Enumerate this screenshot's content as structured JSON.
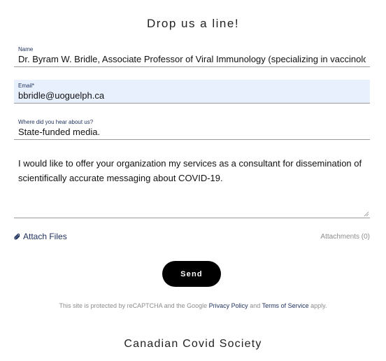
{
  "form": {
    "title": "Drop us a line!",
    "fields": {
      "name": {
        "label": "Name",
        "value": "Dr. Byram W. Bridle, Associate Professor of Viral Immunology (specializing in vaccinology)"
      },
      "email": {
        "label": "Email*",
        "value": "bbridle@uoguelph.ca"
      },
      "source": {
        "label": "Where did you hear about us?",
        "value": "State-funded media."
      },
      "message": {
        "value": "I would like to offer your organization my services as a consultant for dissemination of scientifically accurate messaging about COVID-19."
      }
    },
    "attach_label": "Attach Files",
    "attachments_count": "Attachments (0)",
    "send_label": "Send"
  },
  "recaptcha": {
    "prefix": "This site is protected by reCAPTCHA and the Google",
    "privacy_link": "Privacy Policy",
    "conjunction": "and",
    "terms_link": "Terms of Service",
    "suffix": "apply."
  },
  "footer": {
    "site_title": "Canadian Covid Society"
  },
  "colors": {
    "accent": "#1d2f5c",
    "autofill_bg": "#e8f0fe",
    "button_bg": "#000000",
    "muted_text": "#8c8c8c"
  },
  "icons": {
    "attach": "paperclip-icon",
    "resize": "resize-handle-icon"
  }
}
